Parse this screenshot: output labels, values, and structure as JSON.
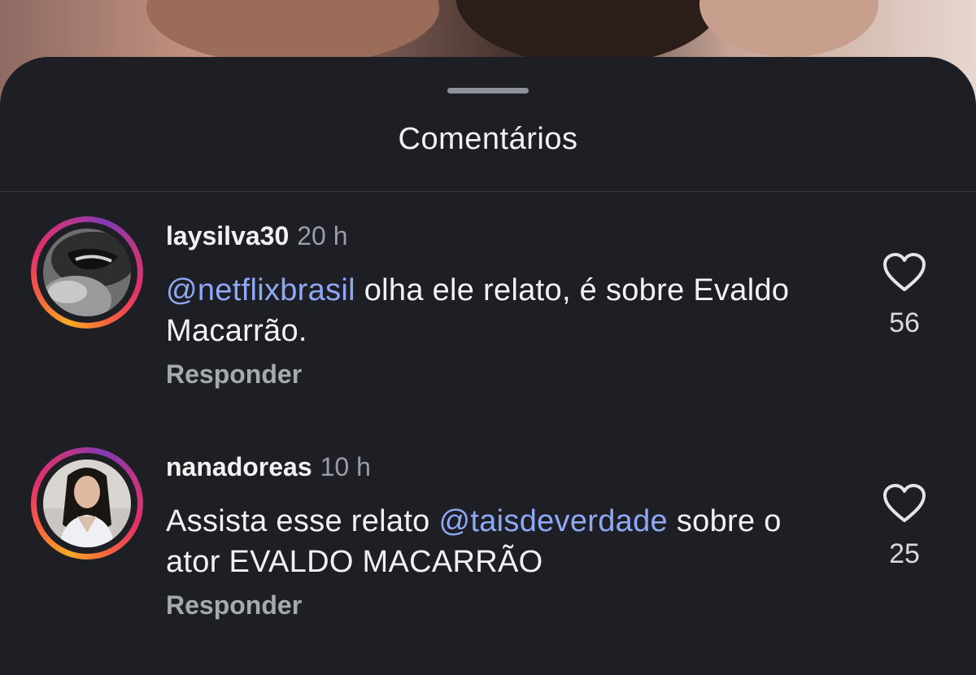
{
  "sheet": {
    "title": "Comentários"
  },
  "comments": [
    {
      "username": "laysilva30",
      "time": "20 h",
      "mention": "@netflixbrasil",
      "text_after_mention": " olha ele relato, é sobre Evaldo Macarrão.",
      "reply_label": "Responder",
      "likes": "56",
      "avatar_icon": "user-photo-bw"
    },
    {
      "username": "nanadoreas",
      "time": "10 h",
      "text_before_mention": "Assista esse relato ",
      "mention": "@taisdeverdade",
      "text_after_mention": " sobre o ator EVALDO MACARRÃO",
      "reply_label": "Responder",
      "likes": "25",
      "avatar_icon": "user-photo-woman"
    }
  ],
  "colors": {
    "sheet_bg": "#1d1f24",
    "mention": "#8fa8f5",
    "muted": "#9a9da3"
  }
}
